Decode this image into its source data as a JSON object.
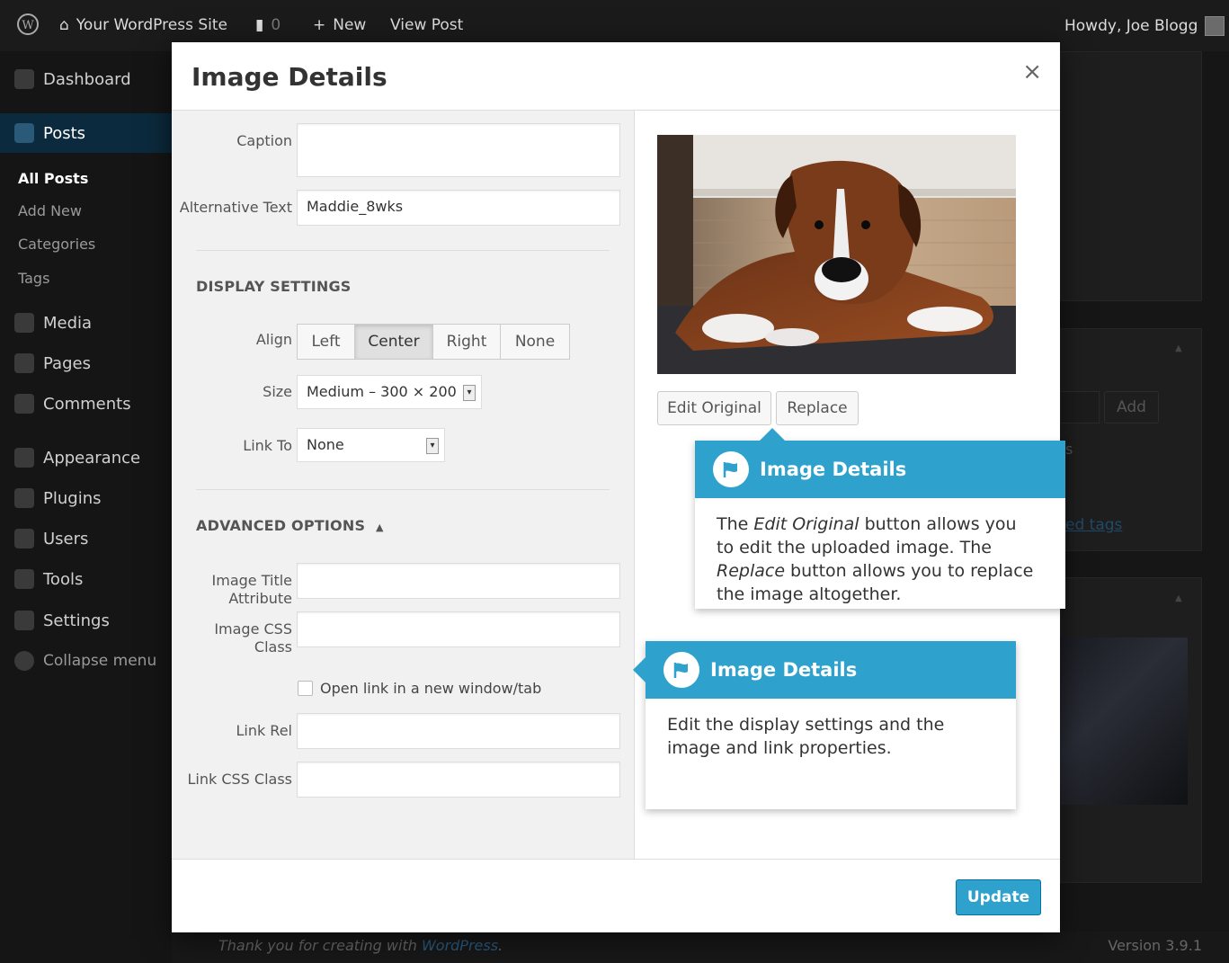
{
  "admin_bar": {
    "site_name": "Your WordPress Site",
    "comments_count": "0",
    "new_label": "New",
    "view_post_label": "View Post",
    "howdy": "Howdy, Joe Blogg"
  },
  "sidebar": {
    "items": [
      {
        "label": "Dashboard",
        "icon": "dashboard-icon"
      },
      {
        "label": "Posts",
        "icon": "pin-icon"
      },
      {
        "label": "Media",
        "icon": "media-icon"
      },
      {
        "label": "Pages",
        "icon": "pages-icon"
      },
      {
        "label": "Comments",
        "icon": "comments-icon"
      },
      {
        "label": "Appearance",
        "icon": "brush-icon"
      },
      {
        "label": "Plugins",
        "icon": "plug-icon"
      },
      {
        "label": "Users",
        "icon": "users-icon"
      },
      {
        "label": "Tools",
        "icon": "wrench-icon"
      },
      {
        "label": "Settings",
        "icon": "settings-icon"
      },
      {
        "label": "Collapse menu",
        "icon": "collapse-icon"
      }
    ],
    "submenu": [
      "All Posts",
      "Add New",
      "Categories",
      "Tags"
    ]
  },
  "background": {
    "add_button": "Add",
    "tags_link": "ed tags",
    "stray_text": "s",
    "footer_thanks": "Thank you for creating with",
    "footer_link": "WordPress",
    "version": "Version 3.9.1"
  },
  "modal": {
    "title": "Image Details",
    "close": "×",
    "caption_label": "Caption",
    "caption_value": "",
    "alt_label": "Alternative Text",
    "alt_value": "Maddie_8wks",
    "display_settings": "DISPLAY SETTINGS",
    "align_label": "Align",
    "align_options": [
      "Left",
      "Center",
      "Right",
      "None"
    ],
    "align_selected": "Center",
    "size_label": "Size",
    "size_value": "Medium – 300 × 200",
    "link_to_label": "Link To",
    "link_to_value": "None",
    "advanced_options": "ADVANCED OPTIONS",
    "image_title_label_1": "Image Title",
    "image_title_label_2": "Attribute",
    "image_css_label_1": "Image CSS",
    "image_css_label_2": "Class",
    "open_new_window_label": "Open link in a new window/tab",
    "link_rel_label": "Link Rel",
    "link_css_label": "Link CSS Class",
    "edit_original": "Edit Original",
    "replace": "Replace",
    "update": "Update"
  },
  "pointers": {
    "top": {
      "title": "Image Details",
      "line1_a": "The ",
      "line1_em": "Edit Original",
      "line1_b": " button allows you",
      "line2": "to edit the uploaded image. The",
      "line3_em": "Replace",
      "line3_b": " button allows you to replace",
      "line4": "the image altogether."
    },
    "bottom": {
      "title": "Image Details",
      "line1": "Edit the display settings and the",
      "line2": "image and link properties."
    }
  },
  "colors": {
    "accent": "#2ea2cc",
    "admin_bar": "#1b1b1b",
    "sidebar": "#151515"
  }
}
